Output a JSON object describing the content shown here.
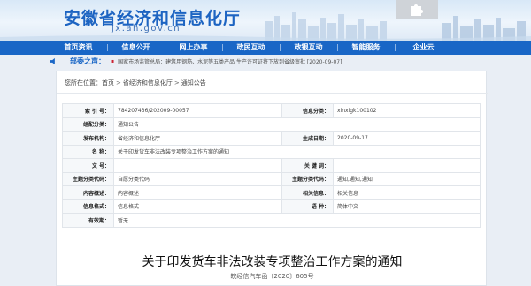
{
  "header": {
    "site_title": "安徽省经济和信息化厅",
    "site_domain": "jx.ah.gov.cn",
    "banner_icon": "puzzle-piece-icon"
  },
  "nav": {
    "items": [
      {
        "label": "首页资讯"
      },
      {
        "label": "信息公开"
      },
      {
        "label": "网上办事"
      },
      {
        "label": "政民互动"
      },
      {
        "label": "政银互动"
      },
      {
        "label": "智能服务"
      },
      {
        "label": "企业云"
      }
    ]
  },
  "ticker": {
    "label": "部委之声：",
    "text": "国家市场监管总局：建筑用钢筋、水泥等五类产品 生产许可证将下放到省级审批 [2020-09-07]"
  },
  "breadcrumb": {
    "prefix": "您所在位置：",
    "items": [
      "首页",
      "省经济和信息化厅",
      "通知公告"
    ],
    "separator": ">"
  },
  "meta": {
    "index_label": "索 引 号：",
    "index_value": "784207436/202009-00057",
    "category_label": "信息分类：",
    "category_value": "xinxigk100102",
    "subject_label": "组配分类：",
    "subject_value": "通知公告",
    "issuer_label": "发布机构：",
    "issuer_value": "省经济和信息化厅",
    "date_label": "生成日期：",
    "date_value": "2020-09-17",
    "name_label": "名 称：",
    "name_value": "关于印发货车非法改装专项整治工作方案的通知",
    "docno_label": "文 号：",
    "docno_value": "",
    "keywords_label": "关 键 词：",
    "keywords_value": "",
    "theme_label": "主题分类代码：",
    "theme_value": "自愿分类代码",
    "subject_code_label": "主题分类代码：",
    "subject_code_value": "通知,通知,通知",
    "content_label": "内容概述：",
    "content_value": "内容概述",
    "related_label": "相关信息：",
    "related_value": "相关信息",
    "format_label": "信息格式：",
    "format_value": "信息格式",
    "lang_label": "语 种：",
    "lang_value": "简体中文",
    "validity_label": "有效期：",
    "validity_value": "暂无"
  },
  "document": {
    "title": "关于印发货车非法改装专项整治工作方案的通知",
    "number": "皖经信汽车函〔2020〕605号"
  },
  "colors": {
    "nav_bg": "#1966c6",
    "title_blue": "#1d64c2"
  }
}
